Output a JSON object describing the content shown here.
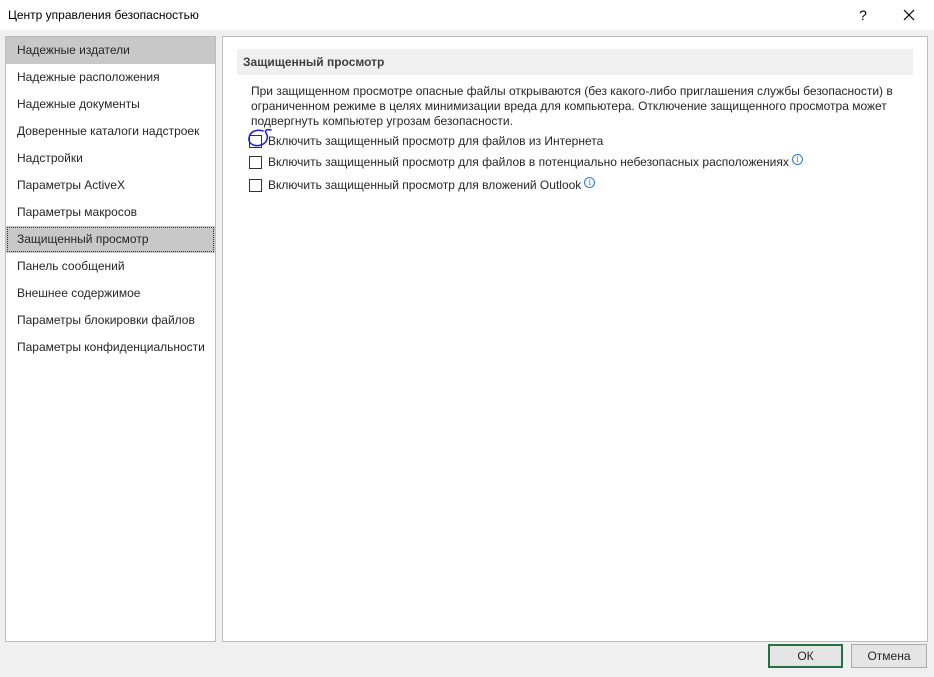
{
  "window": {
    "title": "Центр управления безопасностью",
    "help_label": "?",
    "close_icon": "close-icon"
  },
  "sidebar": {
    "items": [
      {
        "label": "Надежные издатели"
      },
      {
        "label": "Надежные расположения"
      },
      {
        "label": "Надежные документы"
      },
      {
        "label": "Доверенные каталоги надстроек"
      },
      {
        "label": "Надстройки"
      },
      {
        "label": "Параметры ActiveX"
      },
      {
        "label": "Параметры макросов"
      },
      {
        "label": "Защищенный просмотр"
      },
      {
        "label": "Панель сообщений"
      },
      {
        "label": "Внешнее содержимое"
      },
      {
        "label": "Параметры блокировки файлов"
      },
      {
        "label": "Параметры конфиденциальности"
      }
    ],
    "selected_index": 7
  },
  "main": {
    "section_title": "Защищенный просмотр",
    "description": "При защищенном просмотре опасные файлы открываются (без какого-либо приглашения службы безопасности) в ограниченном режиме в целях минимизации вреда для компьютера. Отключение защищенного просмотра может подвергнуть компьютер угрозам безопасности.",
    "options": [
      {
        "label": "Включить защищенный просмотр для файлов из Интернета",
        "checked": false,
        "info": false
      },
      {
        "label": "Включить защищенный просмотр для файлов в потенциально небезопасных расположениях",
        "checked": false,
        "info": true
      },
      {
        "label": "Включить защищенный просмотр для вложений Outlook",
        "checked": false,
        "info": true
      }
    ],
    "annotation_color": "#1a1adb"
  },
  "footer": {
    "ok_label": "ОК",
    "cancel_label": "Отмена",
    "ok_border_color": "#217346"
  }
}
